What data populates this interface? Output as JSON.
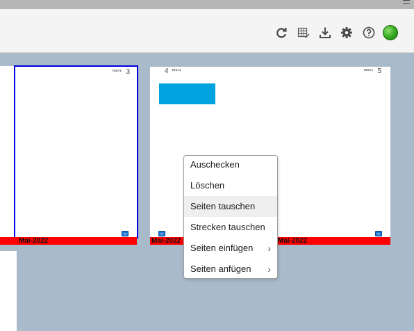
{
  "toolbar": {
    "icons": [
      "refresh-icon",
      "grid-edit-icon",
      "download-icon",
      "gear-icon",
      "help-icon"
    ],
    "status_color": "#2fa51d"
  },
  "pages": [
    {
      "number": "3",
      "tag": "TEXT1",
      "selected": true
    },
    {
      "number": "4",
      "tag": "TEXT1",
      "selected": false
    },
    {
      "number": "5",
      "tag": "TEXT1",
      "selected": false
    }
  ],
  "bars": {
    "left_label": "Mai-2022",
    "middle_label": "Mai-2022",
    "right_label": "Mai-2022"
  },
  "context_menu": {
    "items": [
      {
        "label": "Auschecken",
        "submenu": false
      },
      {
        "label": "Löschen",
        "submenu": false
      },
      {
        "label": "Seiten tauschen",
        "submenu": false
      },
      {
        "label": "Strecken tauschen",
        "submenu": false
      },
      {
        "label": "Seiten einfügen",
        "submenu": true
      },
      {
        "label": "Seiten anfügen",
        "submenu": true
      }
    ]
  },
  "colors": {
    "background": "#a9bacb",
    "selection": "#0000e0",
    "accent_bar": "#ff0000",
    "image_block": "#00a2e0"
  }
}
